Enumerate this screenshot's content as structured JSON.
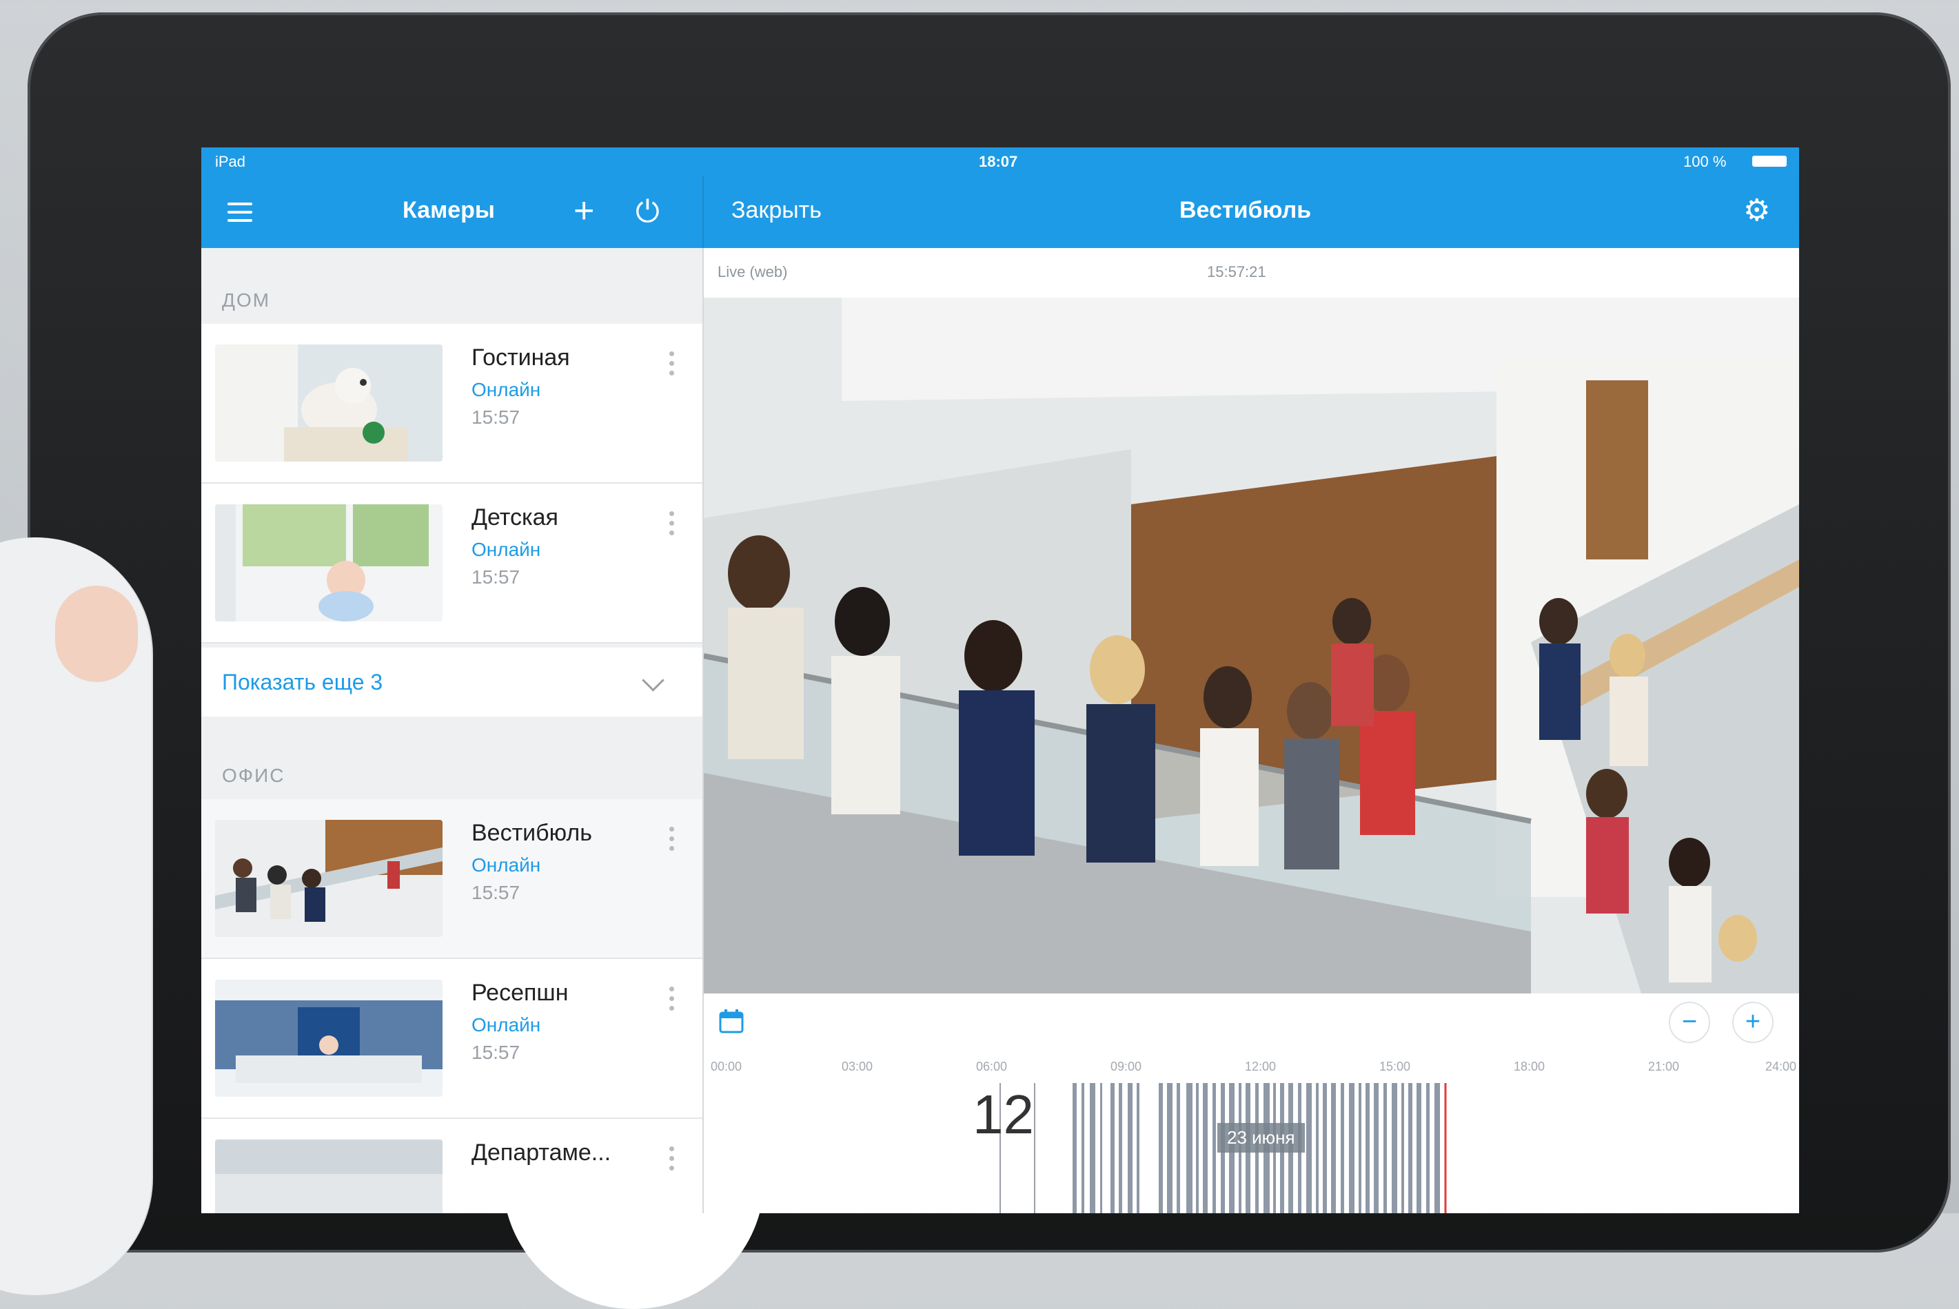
{
  "status_bar": {
    "carrier": "iPad",
    "time": "18:07",
    "battery": "100 %"
  },
  "left_header": {
    "title": "Камеры"
  },
  "right_header": {
    "close_label": "Закрыть",
    "title": "Вестибюль"
  },
  "sections": [
    {
      "title": "ДОМ",
      "cameras": [
        {
          "name": "Гостиная",
          "status": "Онлайн",
          "time": "15:57"
        },
        {
          "name": "Детская",
          "status": "Онлайн",
          "time": "15:57"
        }
      ],
      "show_more": "Показать еще 3"
    },
    {
      "title": "ОФИС",
      "cameras": [
        {
          "name": "Вестибюль",
          "status": "Онлайн",
          "time": "15:57"
        },
        {
          "name": "Ресепшн",
          "status": "Онлайн",
          "time": "15:57"
        },
        {
          "name": "Департаме..."
        }
      ]
    }
  ],
  "player": {
    "source_label": "Live (web)",
    "timestamp": "15:57:21",
    "zoom_out": "−",
    "zoom_in": "+",
    "ticks": [
      "00:00",
      "03:00",
      "06:00",
      "09:00",
      "12:00",
      "15:00",
      "18:00",
      "21:00",
      "24:00"
    ],
    "scale_number": "12",
    "date_label": "23 июня"
  },
  "colors": {
    "accent": "#1e9be6",
    "status_online": "#1e9be6"
  }
}
